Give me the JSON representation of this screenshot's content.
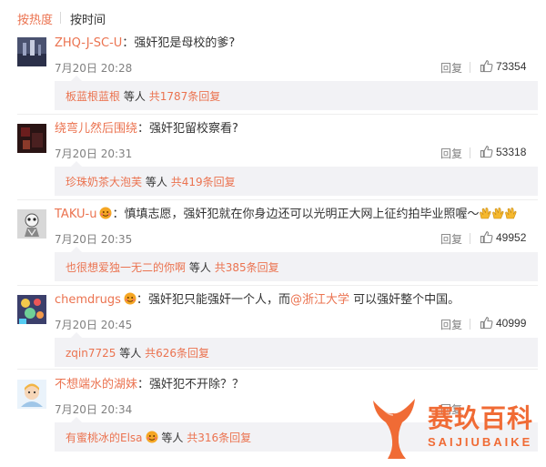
{
  "sort": {
    "hot": "按热度",
    "time": "按时间"
  },
  "comments": [
    {
      "user": "ZHQ-J-SC-U",
      "colon": "：",
      "text": "强奸犯是母校的爹?",
      "time": "7月20日 20:28",
      "reply_label": "回复",
      "likes": "73354",
      "reply_preview": {
        "user": "板蓝根蓝根",
        "mid": "等人",
        "total": "共1787条回复"
      }
    },
    {
      "user": "绕弯儿然后围绕",
      "colon": "：",
      "text": "强奸犯留校察看?",
      "time": "7月20日 20:31",
      "reply_label": "回复",
      "likes": "53318",
      "reply_preview": {
        "user": "珍珠奶茶大泡芙",
        "mid": "等人",
        "total": "共419条回复"
      }
    },
    {
      "user": "TAKU-u",
      "colon": "：",
      "text": "慎填志愿，强奸犯就在你身边还可以光明正大网上征约拍毕业照喔～",
      "time": "7月20日 20:35",
      "reply_label": "回复",
      "likes": "49952",
      "reply_preview": {
        "user": "也很想爱独一无二的你啊",
        "mid": "等人",
        "total": "共385条回复"
      }
    },
    {
      "user": "chemdrugs",
      "colon": "：",
      "text_a": "强奸犯只能强奸一个人，而",
      "mention": "@浙江大学",
      "text_b": " 可以强奸整个中国。",
      "time": "7月20日 20:45",
      "reply_label": "回复",
      "likes": "40999",
      "reply_preview": {
        "user": "zqin7725",
        "mid": "等人",
        "total": "共626条回复"
      }
    },
    {
      "user": "不想端水的湖妹",
      "colon": "：",
      "text": "强奸犯不开除？？",
      "time": "7月20日 20:34",
      "reply_label": "回复",
      "reply_preview": {
        "user": "有蜜桃冰的Elsa",
        "mid": "等人",
        "total": "共316条回复"
      }
    }
  ],
  "watermark": {
    "title": "赛玖百科",
    "subtitle": "SAIJIUBAIKE"
  },
  "colors": {
    "accent": "#eb7350",
    "muted": "#808080",
    "reply_bg": "#f2f2f5",
    "watermark": "#f06b35"
  },
  "icons": [
    "thumbs-up-icon",
    "vip-emoji-icon",
    "clap-icon",
    "whale-tail-logo-icon"
  ]
}
